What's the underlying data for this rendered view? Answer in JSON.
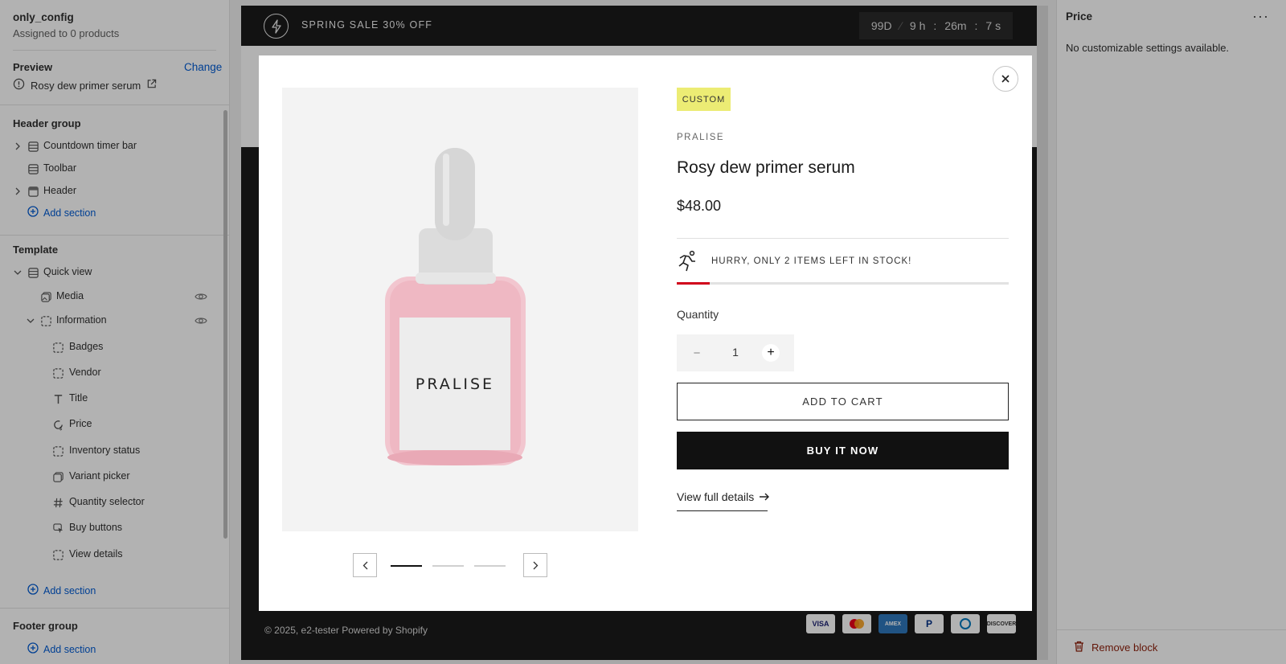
{
  "sidebar": {
    "config_name": "only_config",
    "assigned": "Assigned to 0 products",
    "preview_label": "Preview",
    "change_label": "Change",
    "preview_product": "Rosy dew primer serum",
    "header_group": {
      "title": "Header group",
      "items": [
        "Countdown timer bar",
        "Toolbar",
        "Header"
      ],
      "add_section": "Add section"
    },
    "template": {
      "title": "Template",
      "quick_view": "Quick view",
      "media": "Media",
      "information": "Information",
      "blocks": [
        "Badges",
        "Vendor",
        "Title",
        "Price",
        "Inventory status",
        "Variant picker",
        "Quantity selector",
        "Buy buttons",
        "View details"
      ],
      "add_section": "Add section",
      "selected_block": "Price"
    },
    "footer_group": {
      "title": "Footer group",
      "add_section": "Add section"
    }
  },
  "store": {
    "announcement": "SPRING SALE 30% OFF",
    "timer": {
      "days": "99D",
      "hours": "9 h",
      "minutes": "26m",
      "seconds": "7 s"
    },
    "footer_copy": "© 2025, e2-tester Powered by Shopify",
    "payments": [
      "VISA",
      "Mastercard",
      "AMEX",
      "PayPal",
      "Diners",
      "DISCOVER"
    ]
  },
  "quick_view": {
    "badge": "CUSTOM",
    "vendor": "PRALISE",
    "title": "Rosy dew primer serum",
    "price": "$48.00",
    "stock_message": "HURRY, ONLY 2 ITEMS LEFT IN STOCK!",
    "stock_level": 0.1,
    "quantity_label": "Quantity",
    "quantity_value": "1",
    "add_to_cart": "ADD TO CART",
    "buy_it_now": "BUY IT NOW",
    "view_full_details": "View full details",
    "bottle_label": "PRALISE",
    "gallery_dots": 3,
    "active_dot": 0
  },
  "settings_panel": {
    "title": "Price",
    "message": "No customizable settings available.",
    "remove_block": "Remove block"
  },
  "colors": {
    "link": "#005bd3",
    "badge_bg": "#ecec74",
    "stock_bar": "#d0021b",
    "remove": "#8e1f0b"
  }
}
